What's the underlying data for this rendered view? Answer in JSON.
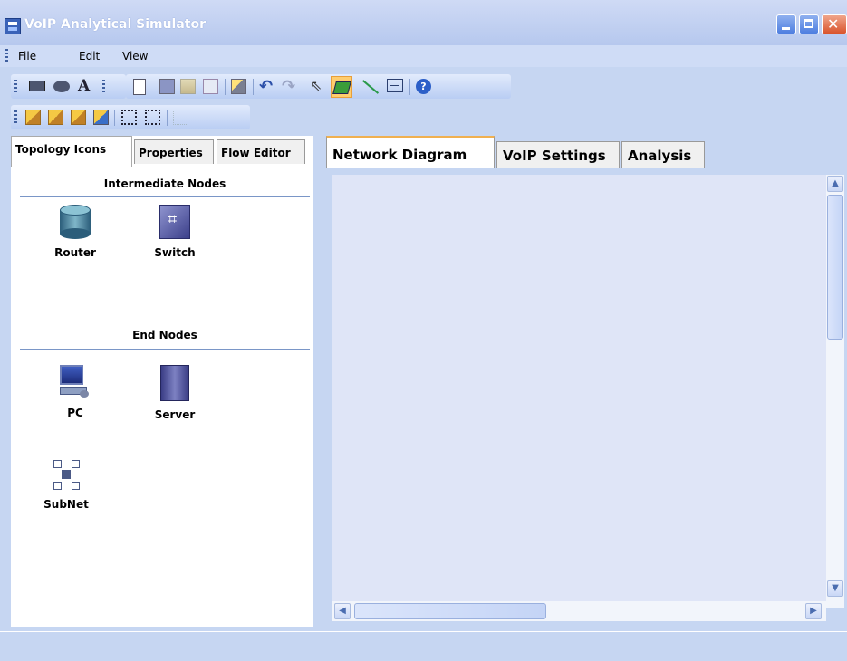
{
  "window": {
    "title": "VoIP Analytical Simulator"
  },
  "menu": [
    "File",
    "Edit",
    "View"
  ],
  "left_tabs": [
    "Topology Icons",
    "Properties",
    "Flow Editor"
  ],
  "sections": {
    "intermediate": {
      "title": "Intermediate Nodes",
      "nodes": [
        "Router",
        "Switch"
      ]
    },
    "end": {
      "title": "End Nodes",
      "nodes": [
        "PC",
        "Server",
        "SubNet"
      ]
    }
  },
  "right_tabs": [
    "Network Diagram",
    "VoIP Settings",
    "Analysis"
  ],
  "colors": {
    "canvas": "#dfe5f7",
    "active_tab_accent": "#f0b050",
    "title_bar": "#b6c8ee"
  }
}
